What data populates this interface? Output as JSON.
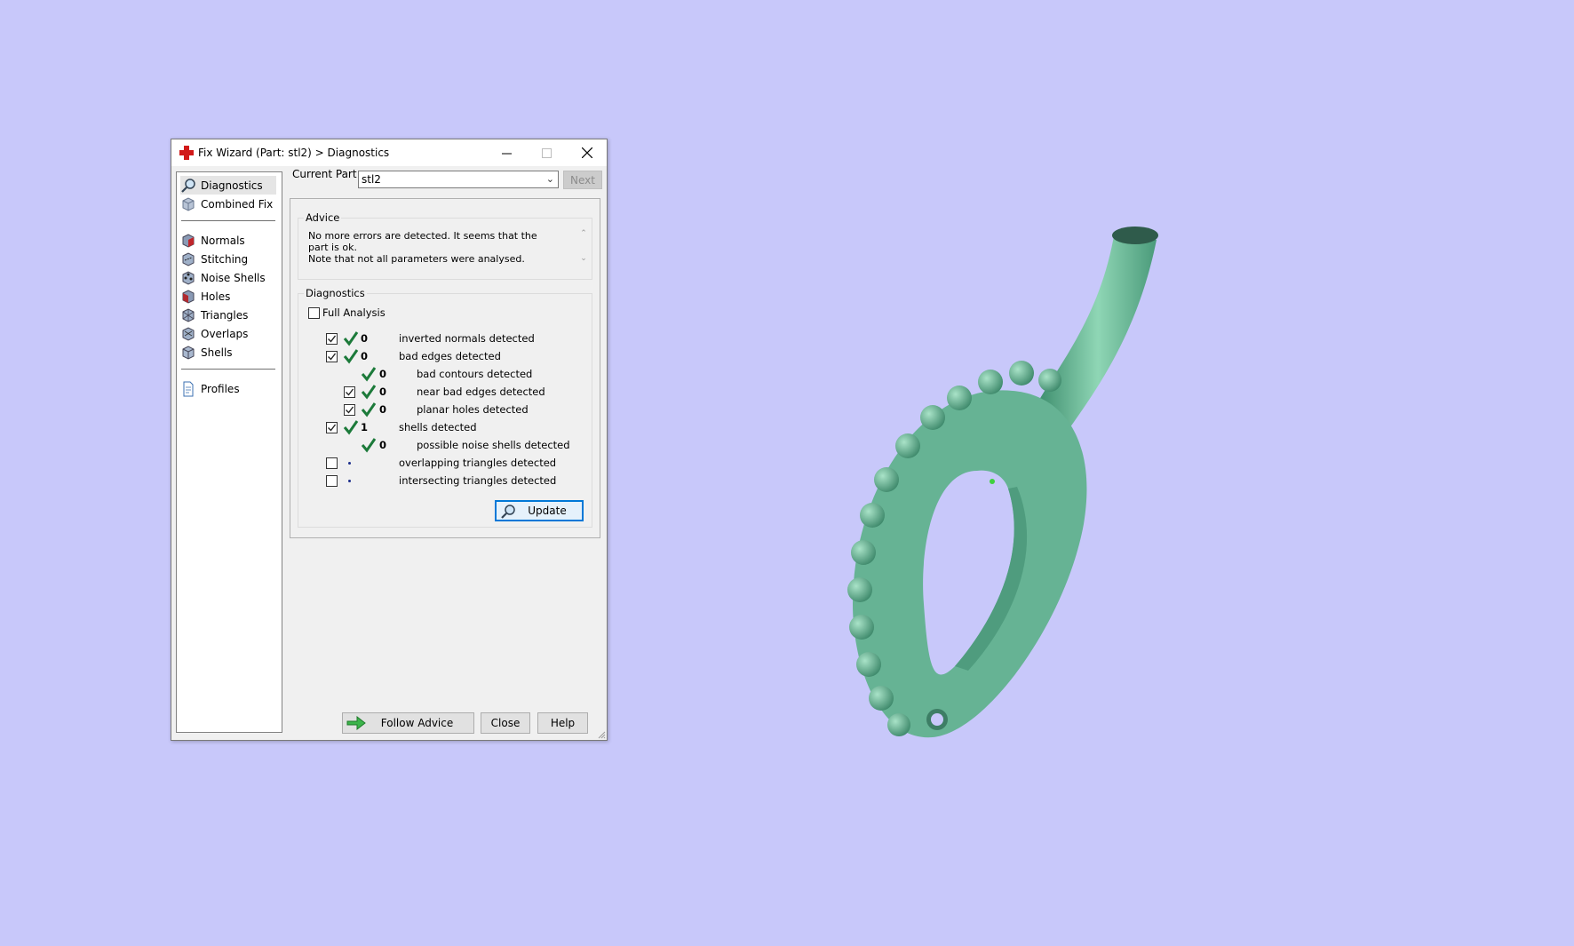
{
  "colors": {
    "desktop_bg": "#c8c8fa",
    "model_fill": "#66b394",
    "check_green": "#1c7a3a",
    "focus_blue": "#0078d7"
  },
  "window": {
    "title": "Fix Wizard (Part: stl2) > Diagnostics",
    "icon": "red-cross-icon"
  },
  "sidebar": {
    "items": [
      {
        "label": "Diagnostics",
        "icon": "magnifier-icon"
      },
      {
        "label": "Combined Fix",
        "icon": "cube-icon"
      },
      {
        "label": "Normals",
        "icon": "cube-red-face-icon"
      },
      {
        "label": "Stitching",
        "icon": "cube-stitch-icon"
      },
      {
        "label": "Noise Shells",
        "icon": "cube-dots-icon"
      },
      {
        "label": "Holes",
        "icon": "cube-hole-icon"
      },
      {
        "label": "Triangles",
        "icon": "cube-triangles-icon"
      },
      {
        "label": "Overlaps",
        "icon": "cube-overlap-icon"
      },
      {
        "label": "Shells",
        "icon": "cube-shell-icon"
      },
      {
        "label": "Profiles",
        "icon": "document-icon"
      }
    ]
  },
  "top": {
    "current_part_label": "Current Part:",
    "current_part_value": "stl2",
    "next_label": "Next"
  },
  "advice": {
    "title": "Advice",
    "line1": "No more errors are detected. It seems that the part is ok.",
    "line2": "Note that not all parameters were analysed."
  },
  "diagnostics": {
    "title": "Diagnostics",
    "full_analysis_label": "Full Analysis",
    "rows": [
      {
        "checkbox": true,
        "status": "ok",
        "count": "0",
        "label": "inverted normals detected"
      },
      {
        "checkbox": true,
        "status": "ok",
        "count": "0",
        "label": "bad edges detected"
      },
      {
        "checkbox": null,
        "status": "ok",
        "count": "0",
        "label": "bad contours detected"
      },
      {
        "checkbox": true,
        "status": "ok",
        "count": "0",
        "label": "near bad edges detected"
      },
      {
        "checkbox": true,
        "status": "ok",
        "count": "0",
        "label": "planar holes detected"
      },
      {
        "checkbox": true,
        "status": "ok",
        "count": "1",
        "label": "shells detected"
      },
      {
        "checkbox": null,
        "status": "ok",
        "count": "0",
        "label": "possible noise shells detected"
      },
      {
        "checkbox": false,
        "status": "pending",
        "count": "",
        "label": "overlapping triangles detected"
      },
      {
        "checkbox": false,
        "status": "pending",
        "count": "",
        "label": "intersecting triangles detected"
      }
    ],
    "update_label": "Update"
  },
  "buttons": {
    "follow_advice": "Follow Advice",
    "close": "Close",
    "help": "Help"
  }
}
